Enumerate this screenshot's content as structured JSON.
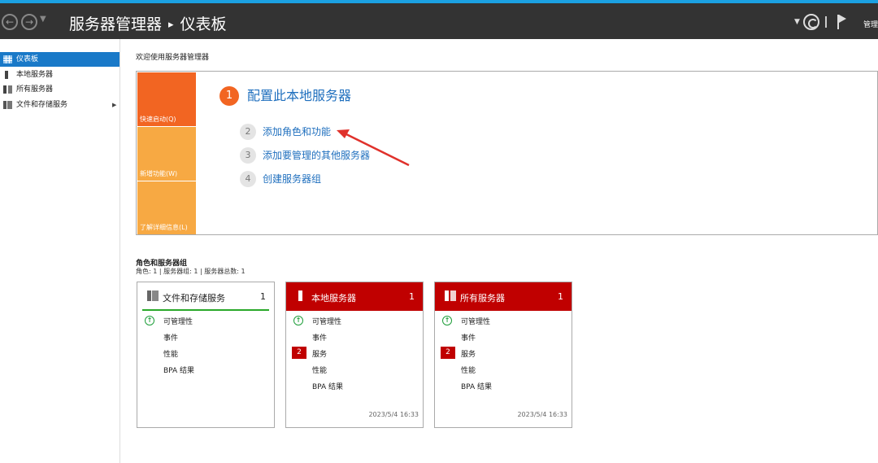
{
  "titlebar": {
    "breadcrumb_root": "服务器管理器",
    "breadcrumb_sep": "▸",
    "breadcrumb_page": "仪表板",
    "manage_label": "管理"
  },
  "sidebar": {
    "items": [
      {
        "label": "仪表板",
        "icon": "dashboard-icon",
        "active": true
      },
      {
        "label": "本地服务器",
        "icon": "server-icon"
      },
      {
        "label": "所有服务器",
        "icon": "servers-icon"
      },
      {
        "label": "文件和存储服务",
        "icon": "file-storage-icon",
        "arrow": "▶"
      }
    ]
  },
  "welcome": {
    "title": "欢迎使用服务器管理器",
    "tiles": [
      "快速启动(Q)",
      "新增功能(W)",
      "了解详细信息(L)"
    ],
    "steps": [
      {
        "num": "1",
        "label": "配置此本地服务器"
      },
      {
        "num": "2",
        "label": "添加角色和功能"
      },
      {
        "num": "3",
        "label": "添加要管理的其他服务器"
      },
      {
        "num": "4",
        "label": "创建服务器组"
      }
    ]
  },
  "roles": {
    "title": "角色和服务器组",
    "summary": "角色: 1 | 服务器组: 1 | 服务器总数: 1",
    "cards": [
      {
        "title": "文件和存储服务",
        "count": "1",
        "rows": [
          "可管理性",
          "事件",
          "性能",
          "BPA 结果"
        ],
        "timestamp": ""
      },
      {
        "title": "本地服务器",
        "count": "1",
        "rows": [
          "可管理性",
          "事件",
          "服务",
          "性能",
          "BPA 结果"
        ],
        "badge": "2",
        "timestamp": "2023/5/4 16:33"
      },
      {
        "title": "所有服务器",
        "count": "1",
        "rows": [
          "可管理性",
          "事件",
          "服务",
          "性能",
          "BPA 结果"
        ],
        "badge": "2",
        "timestamp": "2023/5/4 16:33"
      }
    ]
  },
  "colors": {
    "accent_blue": "#1979c8",
    "link_blue": "#1f6fbe",
    "quick_start_orange": "#f26522",
    "tile_orange": "#f7a943",
    "alert_red": "#c00000",
    "ok_green": "#1e9e3a"
  }
}
